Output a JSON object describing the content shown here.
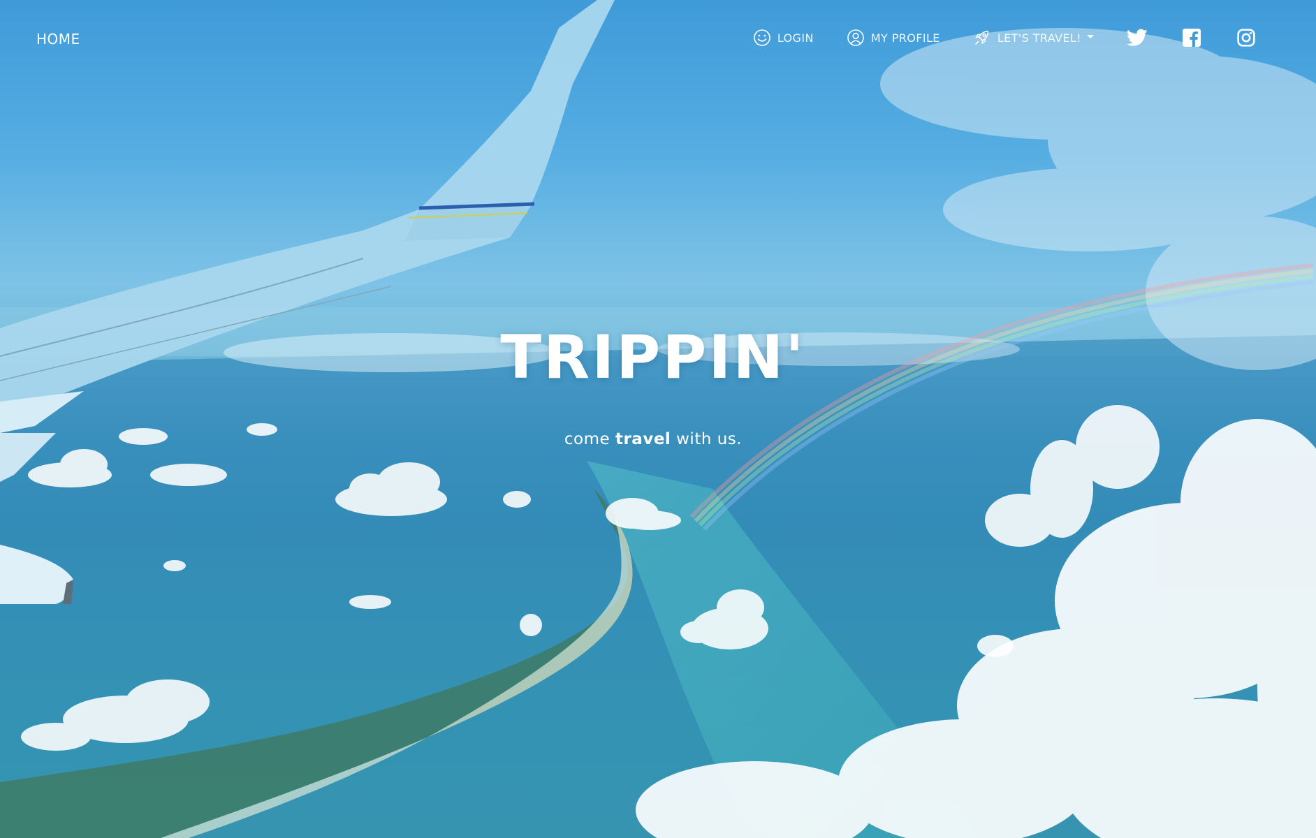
{
  "nav": {
    "home_label": "HOME",
    "items": [
      {
        "label": "LOGIN",
        "icon": "smiley-icon"
      },
      {
        "label": "MY PROFILE",
        "icon": "user-circle-icon"
      },
      {
        "label": "LET'S TRAVEL!",
        "icon": "rocket-icon",
        "dropdown": true
      }
    ],
    "social": [
      "twitter-icon",
      "facebook-icon",
      "instagram-icon"
    ]
  },
  "hero": {
    "title": "TRIPPIN'",
    "tagline_pre": "come",
    "tagline_bold": "travel",
    "tagline_post": "with us."
  },
  "colors": {
    "sky": "#3f9ad8",
    "sea": "#2f8cb6",
    "text": "#ffffff"
  }
}
